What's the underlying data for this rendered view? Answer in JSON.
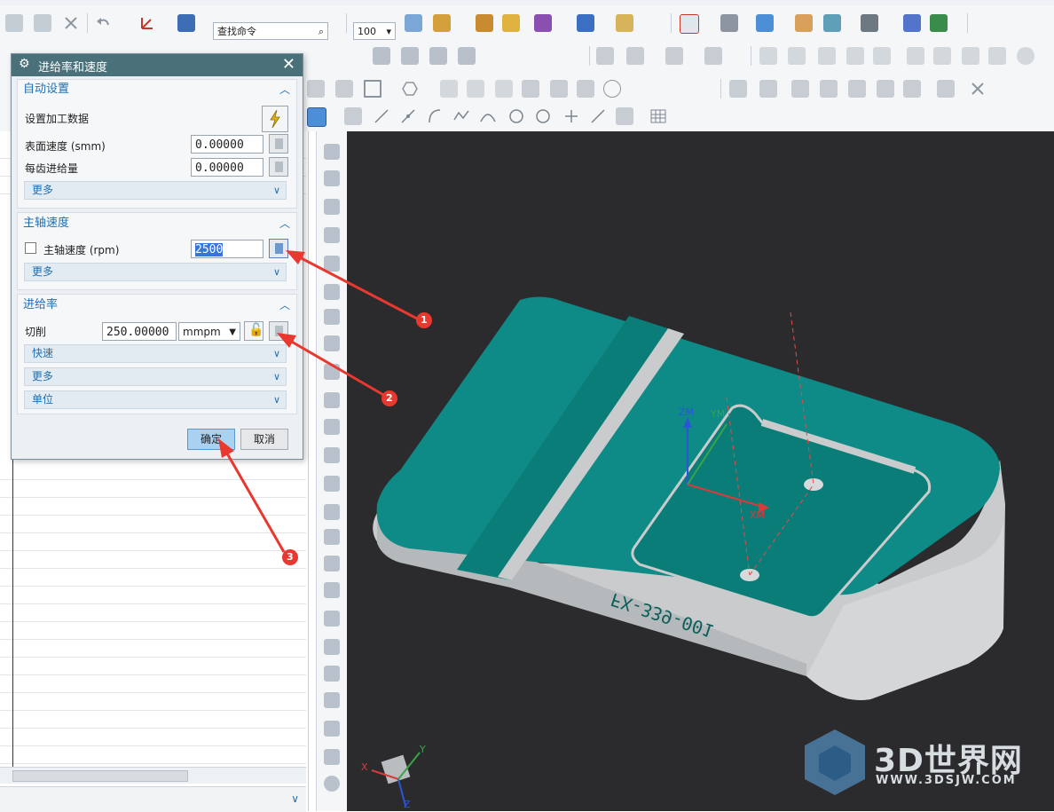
{
  "toolbar": {
    "command_search_placeholder": "查找命令",
    "zoom_value": "100"
  },
  "dialog": {
    "title": "进给率和速度",
    "auto_settings": {
      "title": "自动设置",
      "set_machining_data": "设置加工数据",
      "surface_speed_label": "表面速度 (smm)",
      "surface_speed_value": "0.00000",
      "feed_per_tooth_label": "每齿进给量",
      "feed_per_tooth_value": "0.00000",
      "more": "更多"
    },
    "spindle": {
      "title": "主轴速度",
      "spindle_speed_label": "主轴速度 (rpm)",
      "spindle_speed_value": "2500",
      "more": "更多"
    },
    "feed": {
      "title": "进给率",
      "cut_label": "切削",
      "cut_value": "250.00000",
      "cut_unit": "mmpm",
      "rapid": "快速",
      "more": "更多",
      "unit": "单位"
    },
    "ok": "确定",
    "cancel": "取消"
  },
  "annotations": {
    "marker1": "1",
    "marker2": "2",
    "marker3": "3",
    "arrow_color": "#e8382f"
  },
  "viewport": {
    "axis_zm": "ZM",
    "axis_ym": "YM",
    "axis_xm": "XM",
    "part_engraving": "FX-339-001",
    "triad_x": "X",
    "triad_y": "Y",
    "triad_z": "Z"
  },
  "watermark": {
    "brand": "3D世界网",
    "url": "WWW.3DSJW.COM"
  },
  "colors": {
    "dialog_title_bg": "#4a7179",
    "part_top": "#0e8b86",
    "part_side": "#c9cbcc",
    "viewport_bg": "#2b2b2d",
    "accent_blue": "#1f6fb2"
  }
}
